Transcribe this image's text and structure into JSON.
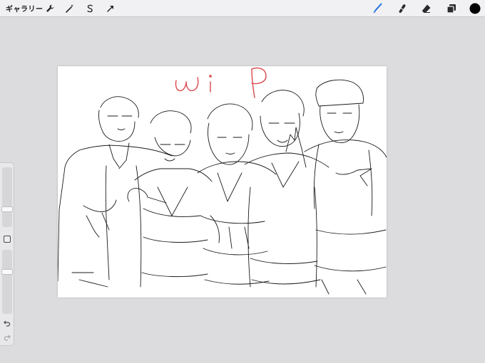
{
  "topbar": {
    "gallery_label": "ギャラリー",
    "left_tools": [
      {
        "name": "actions",
        "icon": "wrench-icon"
      },
      {
        "name": "adjustments",
        "icon": "magic-wand-icon"
      },
      {
        "name": "selection",
        "icon": "selection-s-icon"
      },
      {
        "name": "transform",
        "icon": "arrow-cursor-icon"
      }
    ],
    "right_tools": [
      {
        "name": "brush",
        "icon": "brush-icon",
        "active": true
      },
      {
        "name": "smudge",
        "icon": "smudge-icon"
      },
      {
        "name": "eraser",
        "icon": "eraser-icon"
      },
      {
        "name": "layers",
        "icon": "layers-icon"
      },
      {
        "name": "color",
        "icon": "color-swatch-icon"
      }
    ],
    "active_color": "#1f6fe0",
    "current_color": "#000000"
  },
  "canvas": {
    "annotation_text": "wip",
    "annotation_color": "#d9484a",
    "stroke_color": "#1a1a1a"
  },
  "sidebar": {
    "brush_size_level": 0.27,
    "opacity_level": 0.67,
    "undo_icon": "undo-icon",
    "redo_icon": "redo-icon"
  }
}
